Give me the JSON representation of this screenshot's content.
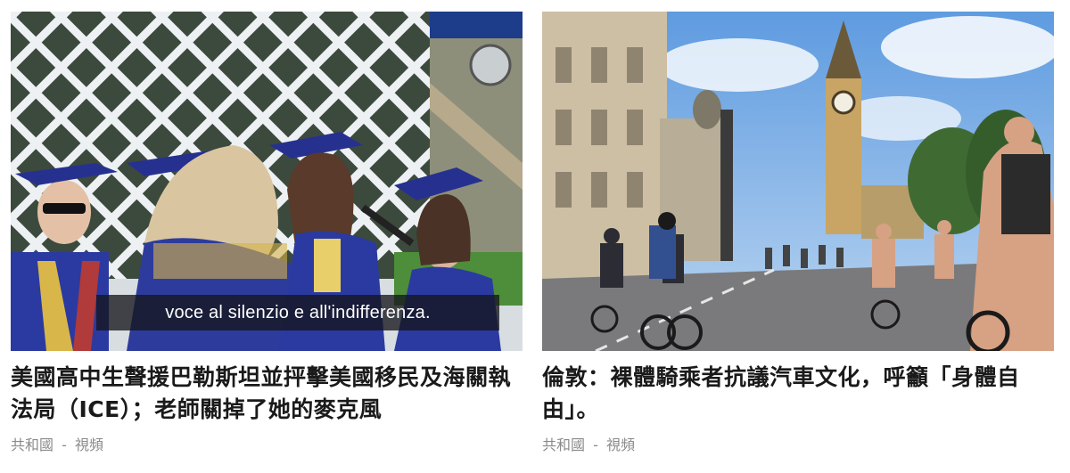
{
  "cards": [
    {
      "headline": "美國高中生聲援巴勒斯坦並抨擊美國移民及海關執法局（ICE）；老師關掉了她的麥克風",
      "subtitle_caption": "voce al silenzio e all'indifferenza.",
      "source": "共和國",
      "separator": "-",
      "type": "視頻"
    },
    {
      "headline": "倫敦：裸體騎乘者抗議汽車文化，呼籲「身體自由」。",
      "source": "共和國",
      "separator": "-",
      "type": "視頻"
    }
  ],
  "colors": {
    "gown_blue": "#2f3fa8",
    "headline": "#1a1a1a",
    "meta": "#8a8a8a"
  }
}
